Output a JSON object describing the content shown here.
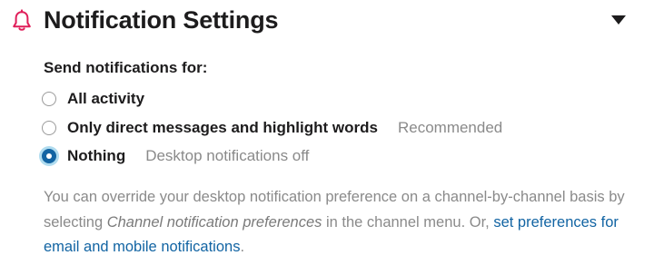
{
  "header": {
    "icon": "bell-icon",
    "title": "Notification Settings",
    "collapse_icon": "caret-down-icon"
  },
  "notifications": {
    "label": "Send notifications for:",
    "options": [
      {
        "label": "All activity",
        "hint": "",
        "selected": false
      },
      {
        "label": "Only direct messages and highlight words",
        "hint": "Recommended",
        "selected": false
      },
      {
        "label": "Nothing",
        "hint": "Desktop notifications off",
        "selected": true
      }
    ]
  },
  "help": {
    "text_before": "You can override your desktop notification preference on a channel-by-channel basis by selecting ",
    "emphasis": "Channel notification preferences",
    "text_middle": " in the channel menu. Or, ",
    "link": "set preferences for email and mobile notifications",
    "text_after": "."
  },
  "colors": {
    "accent": "#1264a3",
    "bell": "#e01e5a",
    "muted_text": "#8a8a8a"
  }
}
